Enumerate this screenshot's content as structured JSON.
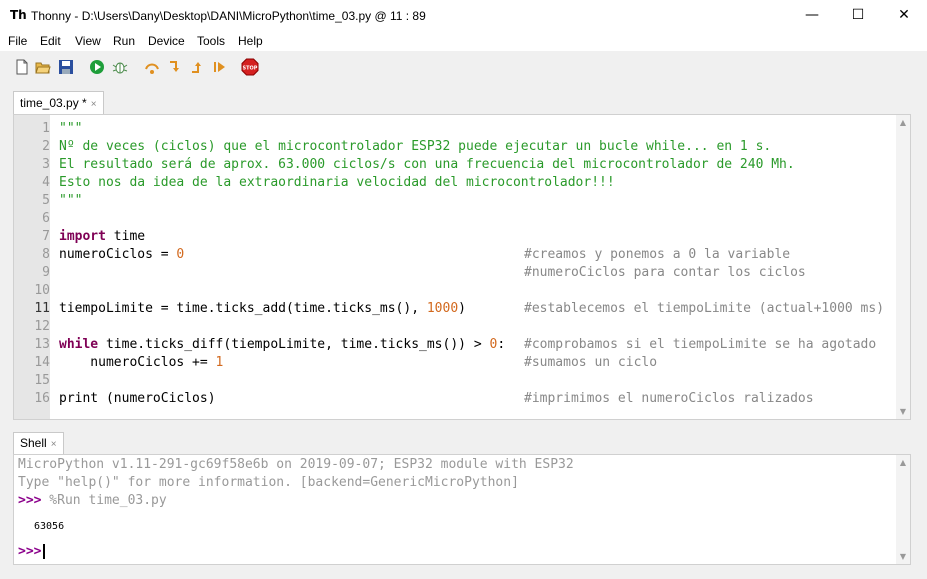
{
  "window": {
    "title": "Thonny  -  D:\\Users\\Dany\\Desktop\\DANI\\MicroPython\\time_03.py  @  11 : 89",
    "app_icon": "Th",
    "minimize": "—",
    "maximize": "☐",
    "close": "✕"
  },
  "menu": [
    "File",
    "Edit",
    "View",
    "Run",
    "Device",
    "Tools",
    "Help"
  ],
  "toolbar": {
    "icons": [
      "new-file-icon",
      "open-folder-icon",
      "save-icon",
      "run-icon",
      "debug-icon",
      "step-over-icon",
      "step-into-icon",
      "step-out-icon",
      "resume-icon",
      "stop-icon"
    ],
    "stop_label": "STOP"
  },
  "editor": {
    "tab_label": "time_03.py *",
    "tab_close": "×",
    "line_numbers": [
      "1",
      "2",
      "3",
      "4",
      "5",
      "6",
      "7",
      "8",
      "9",
      "10",
      "11",
      "12",
      "13",
      "14",
      "15",
      "16"
    ],
    "active_line": "11",
    "code": {
      "l1": "\"\"\"",
      "l2": "Nº de veces (ciclos) que el microcontrolador ESP32 puede ejecutar un bucle while... en 1 s.",
      "l3": "El resultado será de aprox. 63.000 ciclos/s con una frecuencia del microcontrolador de 240 Mh.",
      "l4": "Esto nos da idea de la extraordinaria velocidad del microcontrolador!!!",
      "l5": "\"\"\"",
      "l7_kw": "import",
      "l7_rest": " time",
      "l8_code": "numeroCiclos = ",
      "l8_num": "0",
      "l8_cmt": "#creamos y ponemos a 0 la variable",
      "l9_cmt": "#numeroCiclos para contar los ciclos",
      "l11_code": "tiempoLimite = time.ticks_add(time.ticks_ms(), ",
      "l11_num": "1000",
      "l11_end": ")",
      "l11_cmt": "#establecemos el tiempoLimite (actual+1000 ms)",
      "l13_kw": "while",
      "l13_code": " time.ticks_diff(tiempoLimite, time.ticks_ms()) > ",
      "l13_num": "0",
      "l13_end": ":",
      "l13_cmt": "#comprobamos si el tiempoLimite se ha agotado",
      "l14_code": "    numeroCiclos += ",
      "l14_num": "1",
      "l14_cmt": "#sumamos un ciclo",
      "l16_code": "print (numeroCiclos)",
      "l16_cmt": "#imprimimos el numeroCiclos ralizados"
    }
  },
  "shell": {
    "tab_label": "Shell",
    "tab_close": "×",
    "banner1": "MicroPython v1.11-291-gc69f58e6b on 2019-09-07; ESP32 module with ESP32",
    "banner2": "Type \"help()\" for more information. [backend=GenericMicroPython]",
    "prompt": ">>>",
    "run_cmd": " %Run time_03.py",
    "output": "63056"
  },
  "colors": {
    "string": "#2a9a2a",
    "keyword": "#7f0055",
    "number": "#d2691e",
    "comment": "#888888",
    "prompt": "#8b008b"
  }
}
